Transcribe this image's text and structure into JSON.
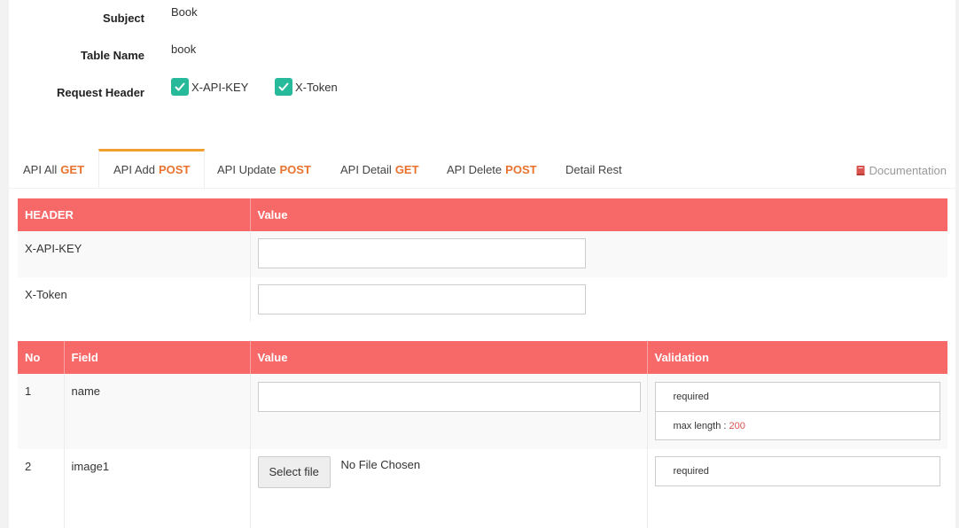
{
  "info": {
    "subject_label": "Subject",
    "subject_value": "Book",
    "table_label": "Table Name",
    "table_value": "book",
    "header_label": "Request Header",
    "headers": [
      {
        "label": "X-API-KEY",
        "checked": true
      },
      {
        "label": "X-Token",
        "checked": true
      }
    ]
  },
  "tabs": [
    {
      "label": "API All",
      "method": "GET"
    },
    {
      "label": "API Add",
      "method": "POST",
      "active": true
    },
    {
      "label": "API Update",
      "method": "POST"
    },
    {
      "label": "API Detail",
      "method": "GET"
    },
    {
      "label": "API Delete",
      "method": "POST"
    },
    {
      "label": "Detail Rest",
      "method": ""
    }
  ],
  "documentation_label": "Documentation",
  "header_table": {
    "columns": [
      "HEADER",
      "Value"
    ],
    "rows": [
      {
        "name": "X-API-KEY",
        "value": ""
      },
      {
        "name": "X-Token",
        "value": ""
      }
    ]
  },
  "field_table": {
    "columns": [
      "No",
      "Field",
      "Value",
      "Validation"
    ],
    "rows": [
      {
        "no": "1",
        "field": "name",
        "value": "",
        "validation_required": "required",
        "validation_max_label": "max length :",
        "validation_max_value": "200"
      },
      {
        "no": "2",
        "field": "image1",
        "file_button": "Select file",
        "file_status": "No File Chosen",
        "validation_required": "required"
      }
    ]
  },
  "colors": {
    "table_header": "#f76868",
    "method": "#e8722e",
    "active_tab": "#f0a030",
    "checkbox": "#26b99a"
  }
}
